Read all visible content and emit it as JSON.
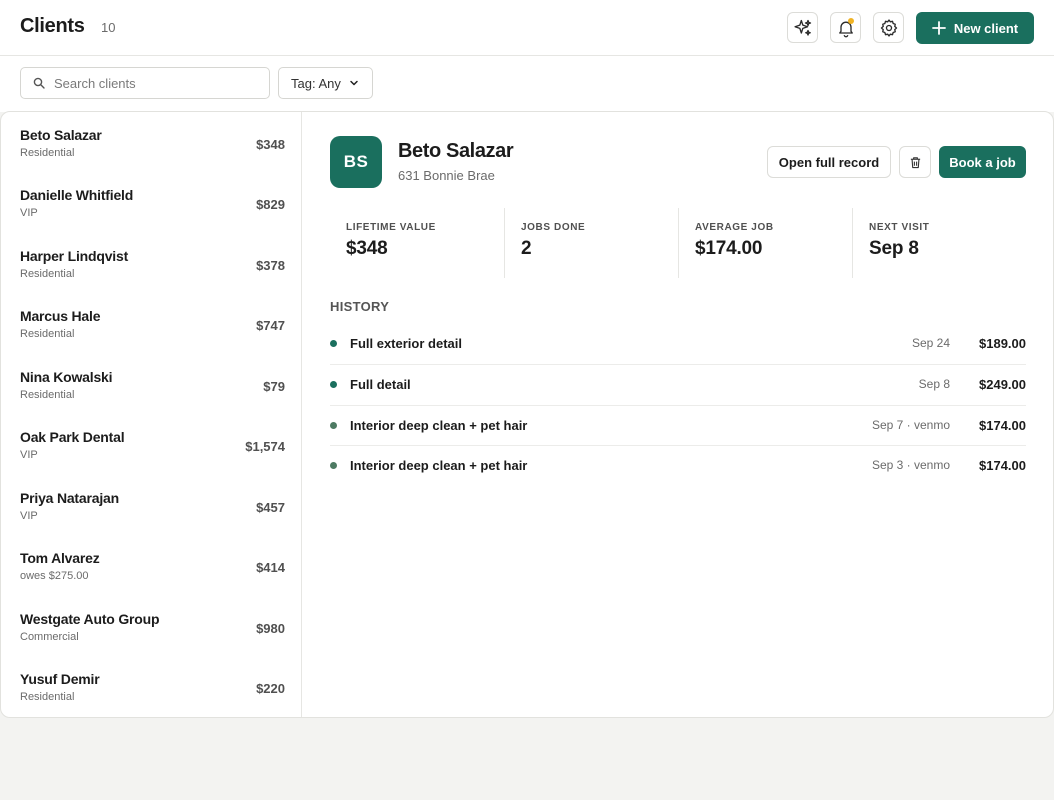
{
  "header": {
    "title": "Clients",
    "count": "10",
    "new_client_label": "New client",
    "icons": [
      "sparkles-icon",
      "bell-icon",
      "gear-icon",
      "plus-icon"
    ],
    "notification_dot_color": "#f0b324"
  },
  "filters": {
    "search_placeholder": "Search clients",
    "search_value": "",
    "tag_label": "Tag: Any"
  },
  "clients": [
    {
      "name": "Beto Salazar",
      "tag": "Residential",
      "value": "$348"
    },
    {
      "name": "Danielle Whitfield",
      "tag": "VIP",
      "value": "$829"
    },
    {
      "name": "Harper Lindqvist",
      "tag": "Residential",
      "value": "$378"
    },
    {
      "name": "Marcus Hale",
      "tag": "Residential",
      "value": "$747"
    },
    {
      "name": "Nina Kowalski",
      "tag": "Residential",
      "value": "$79"
    },
    {
      "name": "Oak Park Dental",
      "tag": "VIP",
      "value": "$1,574"
    },
    {
      "name": "Priya Natarajan",
      "tag": "VIP",
      "value": "$457"
    },
    {
      "name": "Tom Alvarez",
      "tag": "owes $275.00",
      "value": "$414"
    },
    {
      "name": "Westgate Auto Group",
      "tag": "Commercial",
      "value": "$980"
    },
    {
      "name": "Yusuf Demir",
      "tag": "Residential",
      "value": "$220"
    }
  ],
  "detail": {
    "initials": "BS",
    "name": "Beto Salazar",
    "address": "631 Bonnie Brae",
    "open_record_label": "Open full record",
    "book_label": "Book a job",
    "stats": [
      {
        "label": "LIFETIME VALUE",
        "value": "$348"
      },
      {
        "label": "JOBS DONE",
        "value": "2"
      },
      {
        "label": "AVERAGE JOB",
        "value": "$174.00"
      },
      {
        "label": "NEXT VISIT",
        "value": "Sep 8"
      }
    ],
    "history_title": "HISTORY",
    "history": [
      {
        "name": "Full exterior detail",
        "meta": "Sep 24",
        "amount": "$189.00"
      },
      {
        "name": "Full detail",
        "meta": "Sep 8",
        "amount": "$249.00"
      },
      {
        "name": "Interior deep clean + pet hair",
        "meta": "Sep 7 · venmo",
        "amount": "$174.00"
      },
      {
        "name": "Interior deep clean + pet hair",
        "meta": "Sep 3 · venmo",
        "amount": "$174.00"
      }
    ]
  },
  "colors": {
    "accent": "#1a6f5e",
    "background": "#f3f3f1"
  }
}
